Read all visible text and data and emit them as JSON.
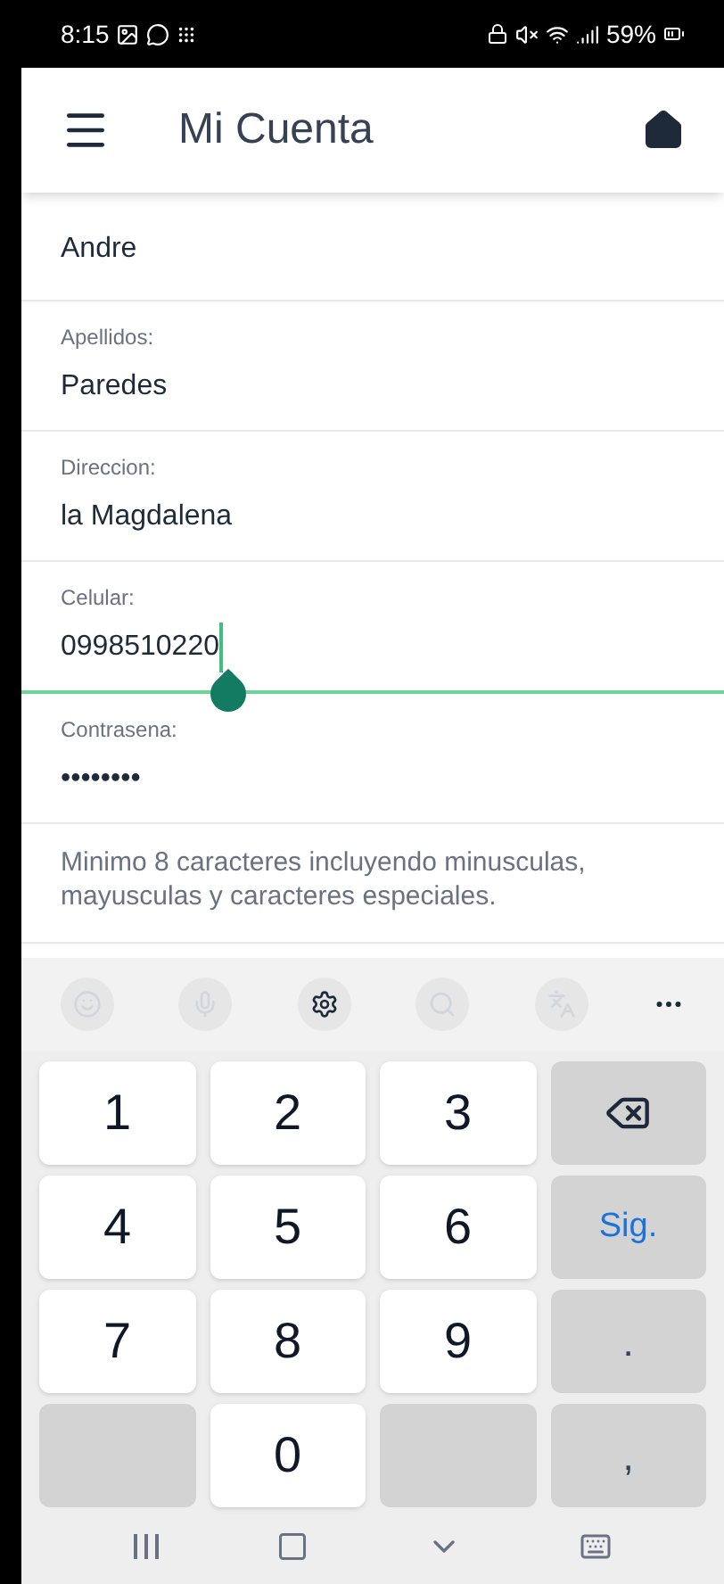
{
  "status_bar": {
    "time": "8:15",
    "battery": "59%"
  },
  "header": {
    "title": "Mi Cuenta"
  },
  "fields": [
    {
      "value": "Andre",
      "focused": false
    },
    {
      "label": "Apellidos:",
      "value": "Paredes",
      "focused": false
    },
    {
      "label": "Direccion:",
      "value": "la Magdalena",
      "focused": false
    },
    {
      "label": "Celular:",
      "value": "0998510220",
      "focused": true
    },
    {
      "label": "Contrasena:",
      "value": "••••••••",
      "focused": false
    }
  ],
  "hint": "Minimo 8 caracteres incluyendo minusculas, mayusculas y caracteres especiales.",
  "keyboard": {
    "keys": [
      {
        "kind": "digit",
        "label": "1"
      },
      {
        "kind": "digit",
        "label": "2"
      },
      {
        "kind": "digit",
        "label": "3"
      },
      {
        "kind": "backspace"
      },
      {
        "kind": "digit",
        "label": "4"
      },
      {
        "kind": "digit",
        "label": "5"
      },
      {
        "kind": "digit",
        "label": "6"
      },
      {
        "kind": "action",
        "label": "Sig."
      },
      {
        "kind": "digit",
        "label": "7"
      },
      {
        "kind": "digit",
        "label": "8"
      },
      {
        "kind": "digit",
        "label": "9"
      },
      {
        "kind": "symbol",
        "label": "."
      },
      {
        "kind": "blank"
      },
      {
        "kind": "digit",
        "label": "0"
      },
      {
        "kind": "blank"
      },
      {
        "kind": "symbol",
        "label": ","
      }
    ]
  }
}
